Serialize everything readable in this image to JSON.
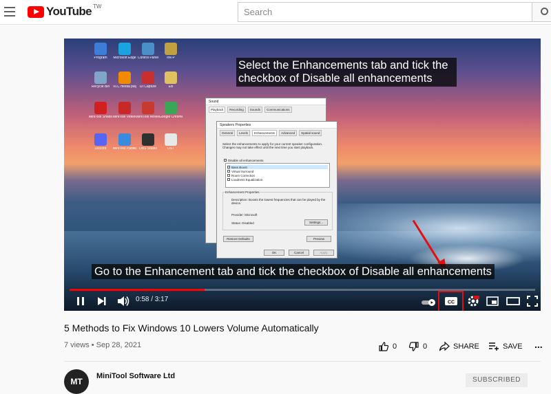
{
  "header": {
    "logo_text": "YouTube",
    "logo_region": "TW",
    "search_placeholder": "Search"
  },
  "video": {
    "caption_top_line1": "Select the Enhancements tab and tick the",
    "caption_top_line2": "checkbox of Disable all enhancements",
    "caption_bottom": "Go to the Enhancement tab and tick the checkbox of Disable all enhancements",
    "time": "0:58 / 3:17",
    "progress_fraction": 0.29,
    "desktop_icons": [
      {
        "label": "Program",
        "color": "#3b7dd8"
      },
      {
        "label": "Microsoft Edge",
        "color": "#1aa3e0"
      },
      {
        "label": "Control Panel",
        "color": "#4a90c8"
      },
      {
        "label": "Ink-P",
        "color": "#c0a040"
      },
      {
        "label": "Recycle Bin",
        "color": "#7fa5c8"
      },
      {
        "label": "VLC media player",
        "color": "#f08a00"
      },
      {
        "label": "UI Capture",
        "color": "#c83030"
      },
      {
        "label": "EB",
        "color": "#e0c060"
      },
      {
        "label": "MiniTool ShadowMaker",
        "color": "#d02020"
      },
      {
        "label": "MiniTool VideoConvert",
        "color": "#c82828"
      },
      {
        "label": "MiniTool MovieMaker",
        "color": "#c83a30"
      },
      {
        "label": "Google Chrome",
        "color": "#3aa757"
      },
      {
        "label": "Discord",
        "color": "#5865f2"
      },
      {
        "label": "MiniTool Partition",
        "color": "#3a8ae0"
      },
      {
        "label": "OBS Studio",
        "color": "#303030"
      },
      {
        "label": "OST",
        "color": "#e8e8e8"
      }
    ],
    "sound_dialog": {
      "title": "Sound",
      "tabs": [
        "Playback",
        "Recording",
        "Sounds",
        "Communications"
      ]
    },
    "props_dialog": {
      "title": "Speakers Properties",
      "tabs": [
        "General",
        "Levels",
        "Enhancements",
        "Advanced",
        "Spatial sound"
      ],
      "intro": "Select the enhancements to apply for your current speaker configuration. Changes may not take effect until the next time you start playback.",
      "disable_all": "Disable all enhancements",
      "options": [
        "Bass Boost",
        "Virtual Surround",
        "Room Correction",
        "Loudness Equalization"
      ],
      "group_title": "Enhancement Properties",
      "description": "Description: Boosts the lowest frequencies that can be played by the device.",
      "provider": "Provider: Microsoft",
      "status": "Status: Disabled",
      "settings_btn": "Settings...",
      "restore_btn": "Restore Defaults",
      "preview_btn": "Preview",
      "ok_btn": "OK",
      "cancel_btn": "Cancel",
      "apply_btn": "Apply"
    }
  },
  "info": {
    "title": "5 Methods to Fix Windows 10 Lowers Volume Automatically",
    "views": "7 views",
    "date": "Sep 28, 2021",
    "likes": "0",
    "dislikes": "0",
    "share": "SHARE",
    "save": "SAVE",
    "more": "...",
    "channel": "MiniTool Software Ltd",
    "avatar_text": "MT",
    "subscribe": "SUBSCRIBED"
  },
  "colors": {
    "youtube_red": "#ff0000",
    "annotation_red": "#e01010"
  }
}
